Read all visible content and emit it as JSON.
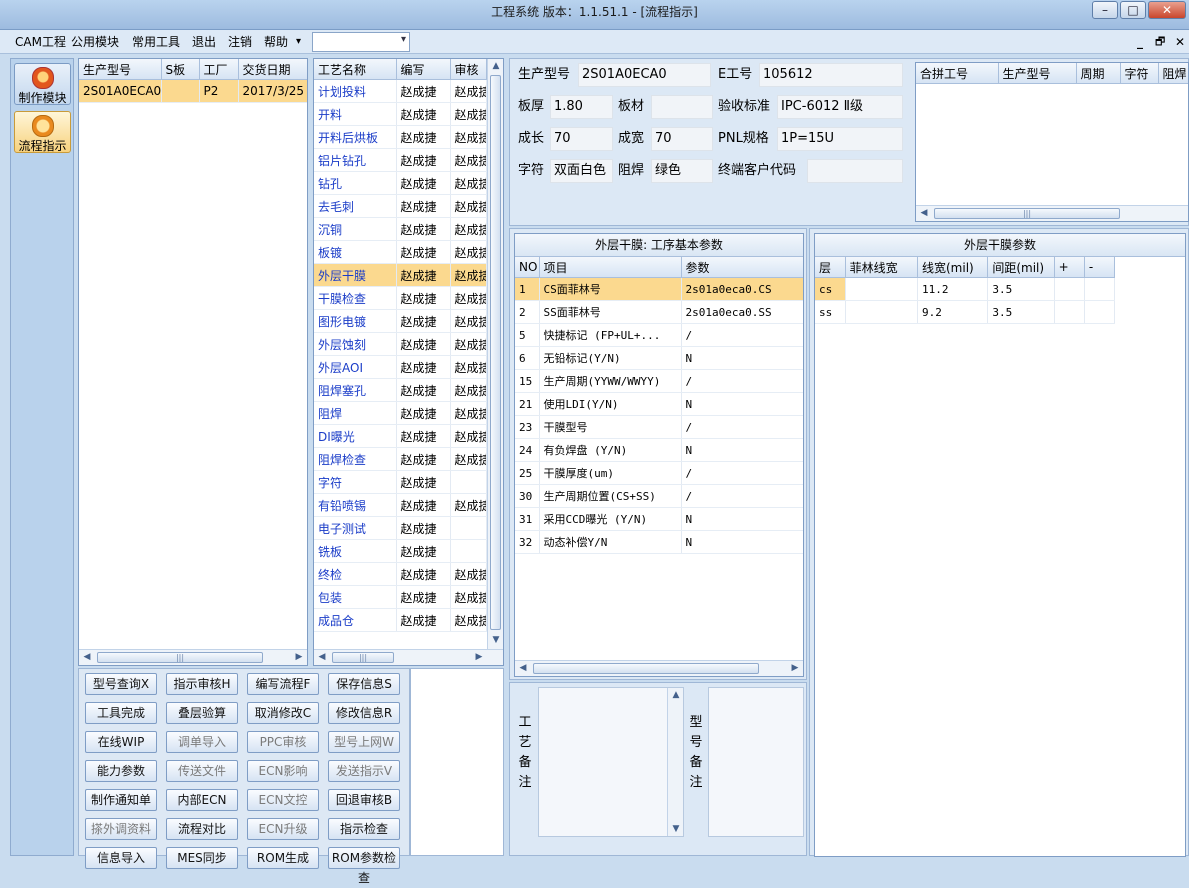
{
  "window": {
    "title": "工程系统   版本：1.1.51.1 - [流程指示]",
    "minimize": "–",
    "maximize": "□",
    "close": "✕"
  },
  "menu": {
    "items": [
      "CAM工程",
      "公用模块",
      "常用工具",
      "退出",
      "注销",
      "帮助"
    ],
    "help_arrow": "▾",
    "combo_value": "",
    "combo_arrow": "▾"
  },
  "mdi_controls": {
    "minimize": "_",
    "restore": "🗗",
    "close": "✕"
  },
  "sidebar": {
    "items": [
      {
        "label": "制作模块"
      },
      {
        "label": "流程指示"
      }
    ]
  },
  "products": {
    "headers": [
      "生产型号",
      "S板",
      "工厂",
      "交货日期"
    ],
    "rows": [
      [
        "2S01A0ECA0",
        "",
        "P2",
        "2017/3/25"
      ]
    ]
  },
  "process": {
    "headers": [
      "工艺名称",
      "编写",
      "审核"
    ],
    "rows": [
      [
        "计划投料",
        "赵成捷",
        "赵成捷"
      ],
      [
        "开料",
        "赵成捷",
        "赵成捷"
      ],
      [
        "开料后烘板",
        "赵成捷",
        "赵成捷"
      ],
      [
        "铝片钻孔",
        "赵成捷",
        "赵成捷"
      ],
      [
        "钻孔",
        "赵成捷",
        "赵成捷"
      ],
      [
        "去毛刺",
        "赵成捷",
        "赵成捷"
      ],
      [
        "沉铜",
        "赵成捷",
        "赵成捷"
      ],
      [
        "板镀",
        "赵成捷",
        "赵成捷"
      ],
      [
        "外层干膜",
        "赵成捷",
        "赵成捷"
      ],
      [
        "干膜检查",
        "赵成捷",
        "赵成捷"
      ],
      [
        "图形电镀",
        "赵成捷",
        "赵成捷"
      ],
      [
        "外层蚀刻",
        "赵成捷",
        "赵成捷"
      ],
      [
        "外层AOI",
        "赵成捷",
        "赵成捷"
      ],
      [
        "阻焊塞孔",
        "赵成捷",
        "赵成捷"
      ],
      [
        "阻焊",
        "赵成捷",
        "赵成捷"
      ],
      [
        "DI曝光",
        "赵成捷",
        "赵成捷"
      ],
      [
        "阻焊检查",
        "赵成捷",
        "赵成捷"
      ],
      [
        "字符",
        "赵成捷",
        ""
      ],
      [
        "有铅喷锡",
        "赵成捷",
        "赵成捷"
      ],
      [
        "电子测试",
        "赵成捷",
        ""
      ],
      [
        "铣板",
        "赵成捷",
        ""
      ],
      [
        "终检",
        "赵成捷",
        "赵成捷"
      ],
      [
        "包装",
        "赵成捷",
        "赵成捷"
      ],
      [
        "成品仓",
        "赵成捷",
        "赵成捷"
      ]
    ]
  },
  "buttons": [
    [
      "型号查询X",
      "指示审核H",
      "编写流程F",
      "保存信息S"
    ],
    [
      "工具完成",
      "叠层验算",
      "取消修改C",
      "修改信息R"
    ],
    [
      "在线WIP",
      "调单导入",
      "PPC审核",
      "型号上网W"
    ],
    [
      "能力参数",
      "传送文件",
      "ECN影响",
      "发送指示V"
    ],
    [
      "制作通知单",
      "内部ECN",
      "ECN文控",
      "回退审核B"
    ],
    [
      "搽外调资料",
      "流程对比",
      "ECN升级",
      "指示检查"
    ],
    [
      "信息导入",
      "MES同步",
      "ROM生成",
      "ROM参数检查"
    ]
  ],
  "info": {
    "model_label": "生产型号",
    "model_value": "2S01A0ECA0",
    "e_label": "E工号",
    "e_value": "105612",
    "thick_label": "板厚",
    "thick_value": "1.80",
    "mat_label": "板材",
    "mat_value": "",
    "std_label": "验收标准",
    "std_value": "IPC-6012 Ⅱ级",
    "len_label": "成长",
    "len_value": "70",
    "wid_label": "成宽",
    "wid_value": "70",
    "pnl_label": "PNL规格",
    "pnl_value": "1P=15U",
    "char_label": "字符",
    "char_value": "双面白色",
    "mask_label": "阻焊",
    "mask_value": "绿色",
    "cust_label": "终端客户代码",
    "cust_value": ""
  },
  "combine": {
    "headers": [
      "合拼工号",
      "生产型号",
      "周期",
      "字符",
      "阻焊"
    ]
  },
  "params": {
    "title": "外层干膜: 工序基本参数",
    "headers": [
      "NO",
      "项目",
      "参数"
    ],
    "rows": [
      [
        "1",
        "CS面菲林号",
        "2s01a0eca0.CS"
      ],
      [
        "2",
        "SS面菲林号",
        "2s01a0eca0.SS"
      ],
      [
        "5",
        "快捷标记 (FP+UL+...",
        "/"
      ],
      [
        "6",
        "无铅标记(Y/N)",
        "N"
      ],
      [
        "15",
        "生产周期(YYWW/WWYY)",
        "/"
      ],
      [
        "21",
        "使用LDI(Y/N)",
        "N"
      ],
      [
        "23",
        "干膜型号",
        "/"
      ],
      [
        "24",
        "有负焊盘 (Y/N)",
        "N"
      ],
      [
        "25",
        "干膜厚度(um)",
        "/"
      ],
      [
        "30",
        "生产周期位置(CS+SS)",
        "/"
      ],
      [
        "31",
        "采用CCD曝光 (Y/N)",
        "N"
      ],
      [
        "32",
        "动态补偿Y/N",
        "N"
      ]
    ]
  },
  "film": {
    "title": "外层干膜参数",
    "headers": [
      "层",
      "菲林线宽",
      "线宽(mil)",
      "间距(mil)",
      "+",
      "-"
    ],
    "rows": [
      [
        "cs",
        "",
        "11.2",
        "3.5",
        "",
        ""
      ],
      [
        "ss",
        "",
        "9.2",
        "3.5",
        "",
        ""
      ]
    ]
  },
  "remarks": {
    "process_label": "工艺备注",
    "model_label": "型号备注"
  },
  "scroll": {
    "left": "◀",
    "right": "▶",
    "up": "▲",
    "down": "▼",
    "grip": "|||"
  }
}
